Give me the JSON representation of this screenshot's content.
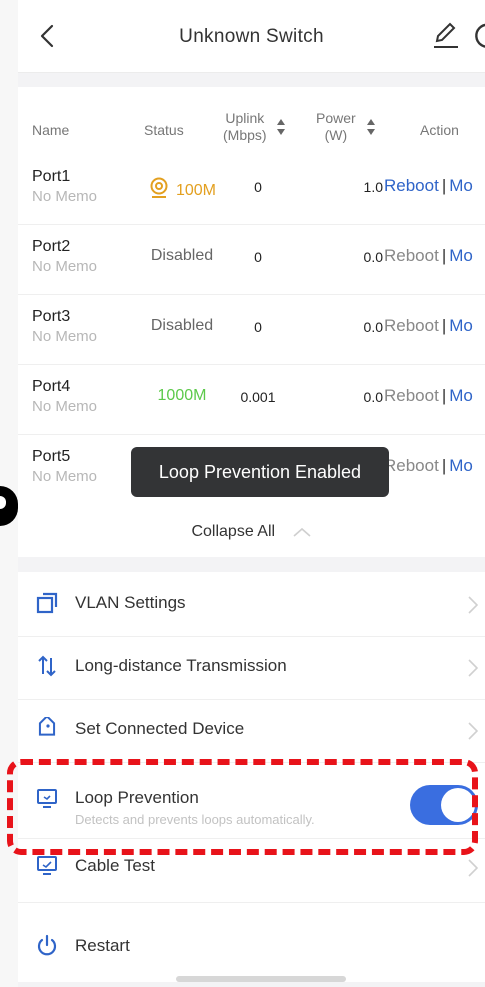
{
  "header": {
    "title": "Unknown Switch"
  },
  "columns": {
    "name": "Name",
    "status": "Status",
    "uplink_line1": "Uplink",
    "uplink_line2": "(Mbps)",
    "power_line1": "Power",
    "power_line2": "(W)",
    "action": "Action"
  },
  "ports": [
    {
      "name": "Port1",
      "memo": "No Memo",
      "status": "100M",
      "uplink": "0",
      "power": "1.0",
      "reboot": "Reboot",
      "sep": "|",
      "more": "Mo"
    },
    {
      "name": "Port2",
      "memo": "No Memo",
      "status": "Disabled",
      "uplink": "0",
      "power": "0.0",
      "reboot": "Reboot",
      "sep": "|",
      "more": "Mo"
    },
    {
      "name": "Port3",
      "memo": "No Memo",
      "status": "Disabled",
      "uplink": "0",
      "power": "0.0",
      "reboot": "Reboot",
      "sep": "|",
      "more": "Mo"
    },
    {
      "name": "Port4",
      "memo": "No Memo",
      "status": "1000M",
      "uplink": "0.001",
      "power": "0.0",
      "reboot": "Reboot",
      "sep": "|",
      "more": "Mo"
    },
    {
      "name": "Port5",
      "memo": "No Memo",
      "reboot": "Reboot",
      "sep": "|",
      "more": "Mo"
    }
  ],
  "collapse_label": "Collapse All",
  "toast": "Loop Prevention Enabled",
  "menu": {
    "vlan": "VLAN Settings",
    "long_distance": "Long-distance Transmission",
    "connected_device": "Set Connected Device",
    "loop_prevention": "Loop Prevention",
    "loop_prevention_desc": "Detects and prevents loops automatically.",
    "loop_prevention_enabled": true,
    "cable_test": "Cable Test",
    "restart": "Restart"
  },
  "colors": {
    "accent": "#2f64c8",
    "toggle_on": "#3a6ee0",
    "status_100m": "#e3a020",
    "status_1000m": "#5cc94a",
    "highlight": "#e8131a"
  }
}
